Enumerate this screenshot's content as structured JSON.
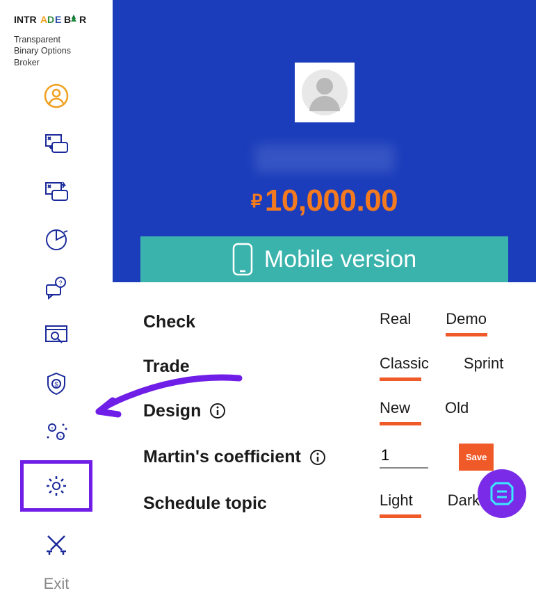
{
  "brand": {
    "tagline": "Transparent\nBinary Options\nBroker"
  },
  "nav": {
    "exit_label": "Exit"
  },
  "header": {
    "currency_symbol": "₽",
    "balance": "10,000.00"
  },
  "mobile": {
    "label": "Mobile version"
  },
  "settings": {
    "check": {
      "label": "Check",
      "opt1": "Real",
      "opt2": "Demo",
      "active": 2
    },
    "trade": {
      "label": "Trade",
      "opt1": "Classic",
      "opt2": "Sprint",
      "active": 1
    },
    "design": {
      "label": "Design",
      "opt1": "New",
      "opt2": "Old",
      "active": 1
    },
    "martin": {
      "label": "Martin's coefficient",
      "value": "1",
      "save_label": "Save"
    },
    "schedule": {
      "label": "Schedule topic",
      "opt1": "Light",
      "opt2": "Dark",
      "active": 1
    }
  },
  "colors": {
    "accent": "#f05a28",
    "primary": "#1b3dbb",
    "teal": "#3bb3ad",
    "purple": "#6e1ee6"
  }
}
